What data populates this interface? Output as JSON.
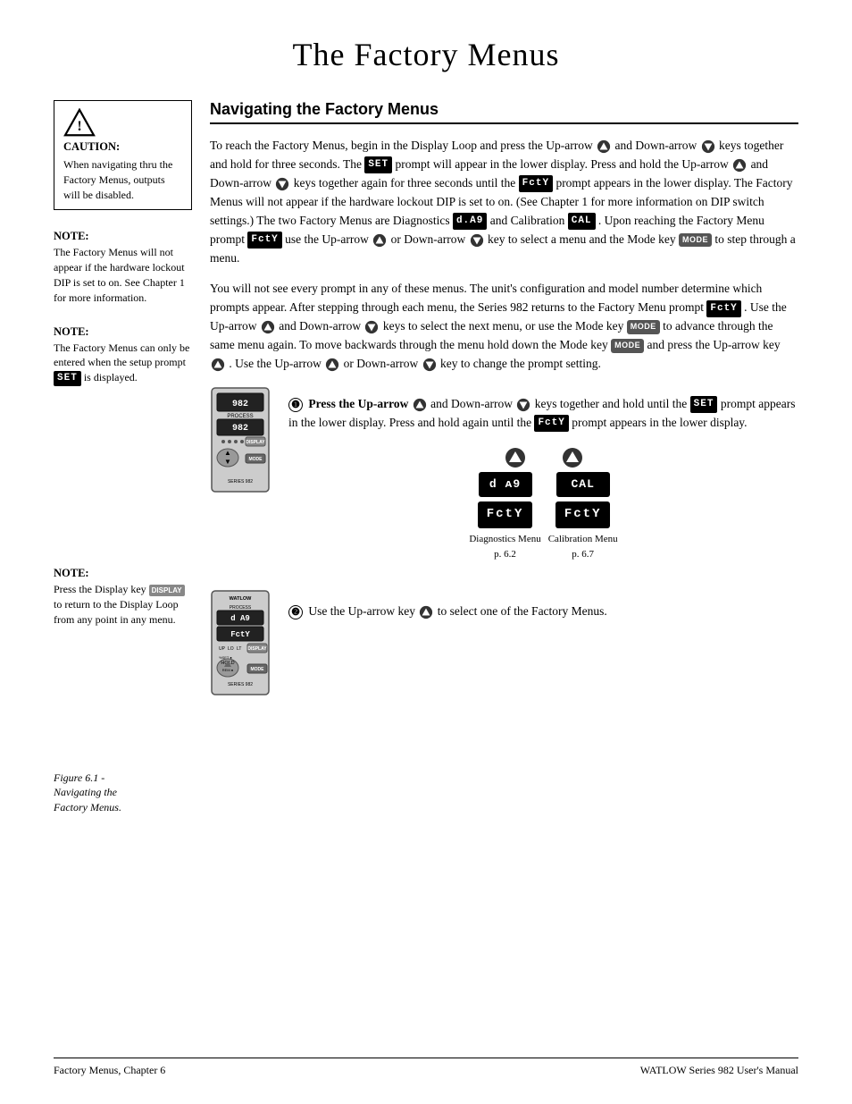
{
  "page": {
    "title": "The Factory Menus",
    "footer_left": "Factory Menus, Chapter 6",
    "footer_right": "WATLOW Series 982 User's Manual"
  },
  "section": {
    "title": "Navigating the Factory Menus",
    "para1": "To reach the Factory Menus, begin in the Display Loop and press the Up-arrow",
    "para1b": "and Down-arrow",
    "para1c": "keys together and hold for three seconds. The",
    "para1d": "SET",
    "para1e": "prompt will appear in the lower display. Press and hold the Up-arrow",
    "para1f": "and Down-arrow",
    "para1g": "keys together again for three seconds until the",
    "para1h": "FctY",
    "para1i": "prompt appears in the lower display. The Factory Menus will not appear if the hardware lockout DIP is set to on. (See Chapter 1 for more information on DIP switch settings.) The two Factory Menus are Diagnostics",
    "para1j": "d.A9",
    "para1k": "and Calibration",
    "para1l": "CAL",
    "para1m": ". Upon reaching the Factory Menu prompt",
    "para1n": "FctY",
    "para1o": "use the Up-arrow",
    "para1p": "or Down-arrow",
    "para1q": "key to select a menu and the Mode key",
    "para1r": "MODE",
    "para1s": "to step through a menu.",
    "para2": "You will not see every prompt in any of these menus. The unit's configuration and model number determine which prompts appear. After stepping through each menu, the Series 982 returns to the Factory Menu prompt",
    "para2a": "FctY",
    "para2b": ". Use the Up-arrow",
    "para2c": "and Down-arrow",
    "para2d": "keys to select the next menu, or use the Mode key",
    "para2e": "MODE",
    "para2f": "to advance through the same menu again. To move backwards through the menu hold down the Mode key",
    "para2g": "MODE",
    "para2h": "and press the Up-arrow key",
    "para2i": ". Use the Up-arrow",
    "para2j": "or Down-arrow",
    "para2k": "key to change the prompt setting."
  },
  "sidebar": {
    "caution_title": "CAUTION:",
    "caution_text": "When navigating thru the Factory Menus, outputs will be disabled.",
    "note1_title": "NOTE:",
    "note1_text": "The Factory Menus will not appear if the hardware lockout DIP is set to on. See Chapter 1 for more information.",
    "note2_title": "NOTE:",
    "note2_text": "The Factory Menus can only be entered when the setup prompt",
    "note2_prompt": "SET",
    "note2_text2": "is displayed.",
    "note3_title": "NOTE:",
    "note3_text": "Press the Display key",
    "note3_display": "DISPLAY",
    "note3_text2": "to return to the Display Loop from any point in any menu."
  },
  "figure1": {
    "step1_circle": "1",
    "step1_text": "Press the Up-arrow",
    "step1b": "and Down-arrow",
    "step1c": "keys together and hold until the",
    "step1d": "SET",
    "step1e": "prompt appears in the lower display. Press and hold again until the",
    "step1f": "FctY",
    "step1g": "prompt appears in the lower display.",
    "diag_menu_label": "Diagnostics Menu",
    "diag_menu_page": "p. 6.2",
    "cal_menu_label": "Calibration Menu",
    "cal_menu_page": "p. 6.7",
    "diag_display": "d A9",
    "cal_display": "CAL",
    "fcty1_display": "FctY",
    "fcty2_display": "FctY"
  },
  "figure2": {
    "step2_circle": "2",
    "step2_text": "Use the Up-arrow key",
    "step2b": "to select one of the Factory Menus.",
    "caption": "Figure 6.1 -\nNavigating the\nFactory Menus."
  }
}
